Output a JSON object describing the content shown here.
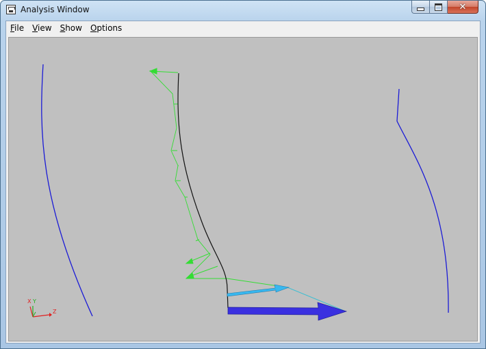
{
  "window": {
    "title": "Analysis Window",
    "close_glyph": "✕"
  },
  "menu": {
    "items": [
      {
        "label": "File",
        "mnemonic": "F",
        "rest": "ile"
      },
      {
        "label": "View",
        "mnemonic": "V",
        "rest": "iew"
      },
      {
        "label": "Show",
        "mnemonic": "S",
        "rest": "how"
      },
      {
        "label": "Options",
        "mnemonic": "O",
        "rest": "ptions"
      }
    ]
  },
  "viewport": {
    "background": "#c0c0c0",
    "triad": {
      "x_label": "X",
      "y_label": "Y",
      "z_label": "Z"
    }
  },
  "colors": {
    "profile_lines": "#1a1ad6",
    "surface_curve": "#111111",
    "pressure_vectors": "#33dd33",
    "velocity_arrow": "#38b8f0",
    "force_arrow": "#3a30e0",
    "axis_x": "#e02020",
    "axis_y": "#20b020",
    "axis_z": "#e02020"
  }
}
